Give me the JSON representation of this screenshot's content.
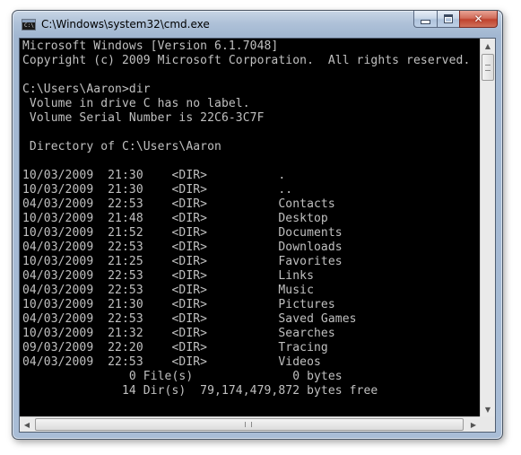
{
  "window": {
    "title": "C:\\Windows\\system32\\cmd.exe",
    "app_icon_text": "C:\\",
    "buttons": {
      "minimize": "minimize-icon",
      "maximize": "maximize-icon",
      "close": "close-icon",
      "close_glyph": "✕"
    }
  },
  "console": {
    "lines": [
      "Microsoft Windows [Version 6.1.7048]",
      "Copyright (c) 2009 Microsoft Corporation.  All rights reserved.",
      "",
      "C:\\Users\\Aaron>dir",
      " Volume in drive C has no label.",
      " Volume Serial Number is 22C6-3C7F",
      "",
      " Directory of C:\\Users\\Aaron",
      "",
      "10/03/2009  21:30    <DIR>          .",
      "10/03/2009  21:30    <DIR>          ..",
      "04/03/2009  22:53    <DIR>          Contacts",
      "10/03/2009  21:48    <DIR>          Desktop",
      "10/03/2009  21:52    <DIR>          Documents",
      "04/03/2009  22:53    <DIR>          Downloads",
      "10/03/2009  21:25    <DIR>          Favorites",
      "04/03/2009  22:53    <DIR>          Links",
      "04/03/2009  22:53    <DIR>          Music",
      "10/03/2009  21:30    <DIR>          Pictures",
      "04/03/2009  22:53    <DIR>          Saved Games",
      "10/03/2009  21:32    <DIR>          Searches",
      "09/03/2009  22:20    <DIR>          Tracing",
      "04/03/2009  22:53    <DIR>          Videos",
      "               0 File(s)              0 bytes",
      "              14 Dir(s)  79,174,479,872 bytes free"
    ]
  },
  "scrollbars": {
    "up_arrow": "▲",
    "down_arrow": "▼",
    "left_arrow": "◀",
    "right_arrow": "▶"
  }
}
